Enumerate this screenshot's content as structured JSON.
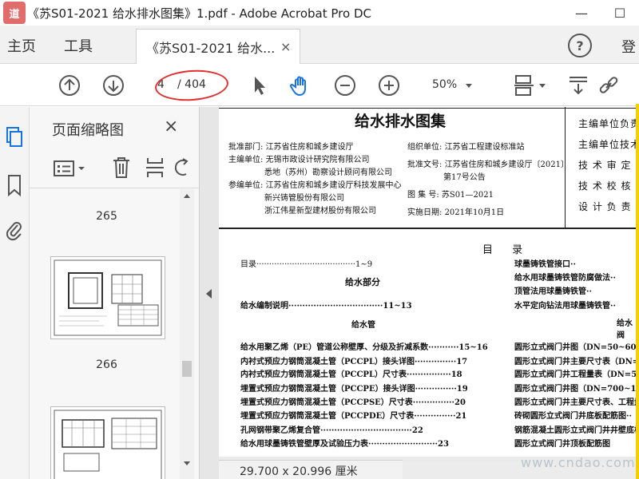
{
  "window": {
    "title": "《苏S01-2021 给水排水图集》1.pdf - Adobe Acrobat Pro DC",
    "logo_text": "道"
  },
  "menu": {
    "home": "主页",
    "tools": "工具",
    "login": "登"
  },
  "tab": {
    "label": "《苏S01-2021 给水...",
    "close": "×"
  },
  "toolbar": {
    "page_current": "4",
    "page_total": "/ 404",
    "zoom": "50%"
  },
  "thumbnail_panel": {
    "title": "页面缩略图",
    "close": "×",
    "pages": [
      "265",
      "266"
    ]
  },
  "status": {
    "page_size": "29.700 x 20.996 厘米"
  },
  "watermark": "www.cndao.com",
  "document": {
    "title": "给水排水图集",
    "meta_left": [
      {
        "label": "批准部门:",
        "value": "江苏省住房和城乡建设厅"
      },
      {
        "label": "主编单位:",
        "value": "无锡市政设计研究院有限公司"
      },
      {
        "label": "",
        "value": "悉地（苏州）勘察设计顾问有限公司"
      },
      {
        "label": "参编单位:",
        "value": "江苏省住房和城乡建设厅科技发展中心"
      },
      {
        "label": "",
        "value": "新兴铸管股份有限公司"
      },
      {
        "label": "",
        "value": "浙江伟星新型建材股份有限公司"
      }
    ],
    "meta_mid": [
      {
        "label": "组织单位:",
        "value": "江苏省工程建设标准站"
      },
      {
        "label": "批准文号:",
        "value": "江苏省住房和城乡建设厅〔2021〕"
      },
      {
        "label": "",
        "value": "第17号公告"
      },
      {
        "label": "图 集 号:",
        "value": "苏S01—2021"
      },
      {
        "label": "实施日期:",
        "value": "2021年10月1日"
      }
    ],
    "meta_right": [
      "主编单位负责人",
      "主编单位技术负责人",
      "技 术 审 定 人",
      "技 术 校 核 人",
      "设 计 负 责 人"
    ],
    "toc_heading": "目 录",
    "toc_left": [
      {
        "text": "目录·······································1~9"
      },
      {
        "text": "给水部分",
        "section": true
      },
      {
        "text": "给水编制说明··································11~13",
        "bold": true
      },
      {
        "text": "给水管",
        "section": true
      },
      {
        "text": "给水用聚乙烯（PE）管道公称壁厚、分级及折减系数···········15~16",
        "bold": true
      },
      {
        "text": "内衬式预应力钢筒混凝土管（PCCPL）接头详图···············17",
        "bold": true
      },
      {
        "text": "内衬式预应力钢筒混凝土管（PCCPL）尺寸表················18",
        "bold": true
      },
      {
        "text": "埋置式预应力钢筒混凝土管（PCCPE）接头详图···············19",
        "bold": true
      },
      {
        "text": "埋置式预应力钢筒混凝土管（PCCPSE）尺寸表···············20",
        "bold": true
      },
      {
        "text": "埋置式预应力钢筒混凝土管（PCCPDE）尺寸表···············21",
        "bold": true
      },
      {
        "text": "孔网钢带聚乙烯复合管·································22",
        "bold": true
      },
      {
        "text": "给水用球墨铸铁管壁厚及试验压力表·························23",
        "bold": true
      }
    ],
    "toc_right": [
      {
        "text": "球墨铸铁管接口··"
      },
      {
        "text": "给水用球墨铸铁管防腐做法··"
      },
      {
        "text": "顶管法用球墨铸铁管··"
      },
      {
        "text": "水平定向钻法用球墨铸铁管··"
      },
      {
        "text": "给水阀",
        "section": true
      },
      {
        "text": "圆形立式阀门井图（DN=50~600）·"
      },
      {
        "text": "圆形立式阀门井主要尺寸表（DN=50~6"
      },
      {
        "text": "圆形立式阀门井工程量表（DN=50~600"
      },
      {
        "text": "圆形立式阀门井图（DN=700~1800）·"
      },
      {
        "text": "圆形立式阀门井主要尺寸表、工程量表"
      },
      {
        "text": "砖砌圆形立式阀门井底板配筋图··"
      },
      {
        "text": "钢筋混凝土圆形立式阀门井井壁底板配"
      },
      {
        "text": "圆形立式阀门井顶板配筋图"
      }
    ]
  }
}
